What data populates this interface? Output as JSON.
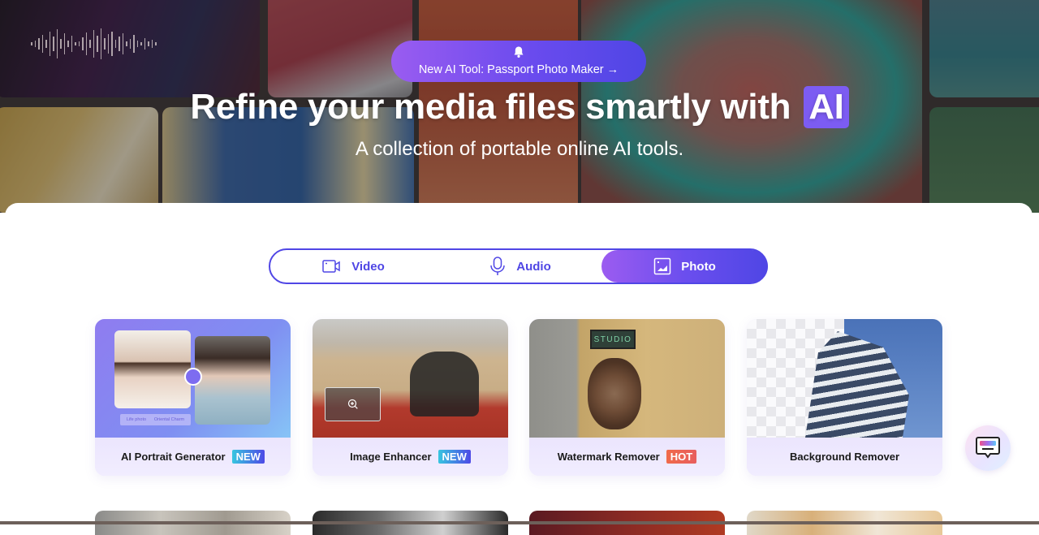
{
  "hero": {
    "announcement": {
      "icon": "bell-icon",
      "text": "New AI Tool: Passport Photo Maker →"
    },
    "headline": "Refine your media files smartly with",
    "headline_badge": "AI",
    "subheadline": "A collection of portable online AI tools.",
    "colors": {
      "announcement_gradient_start": "#9a5cf0",
      "announcement_gradient_end": "#4f46e5",
      "ai_badge": "#7c5cf2"
    }
  },
  "tabs": {
    "active": "Photo",
    "items": [
      {
        "label": "Video",
        "icon": "video-camera-icon"
      },
      {
        "label": "Audio",
        "icon": "microphone-icon"
      },
      {
        "label": "Photo",
        "icon": "image-icon"
      }
    ],
    "accent": "#4f46e5"
  },
  "tools": [
    {
      "label": "AI Portrait Generator",
      "badge": "NEW",
      "thumb_caption_left": "Life photo",
      "thumb_caption_right": "Oriental Charm"
    },
    {
      "label": "Image Enhancer",
      "badge": "NEW"
    },
    {
      "label": "Watermark Remover",
      "badge": "HOT",
      "thumb_sign": "STUDIO"
    },
    {
      "label": "Background Remover",
      "badge": ""
    }
  ],
  "chat_button": {
    "icon": "chat-bubble-icon"
  }
}
